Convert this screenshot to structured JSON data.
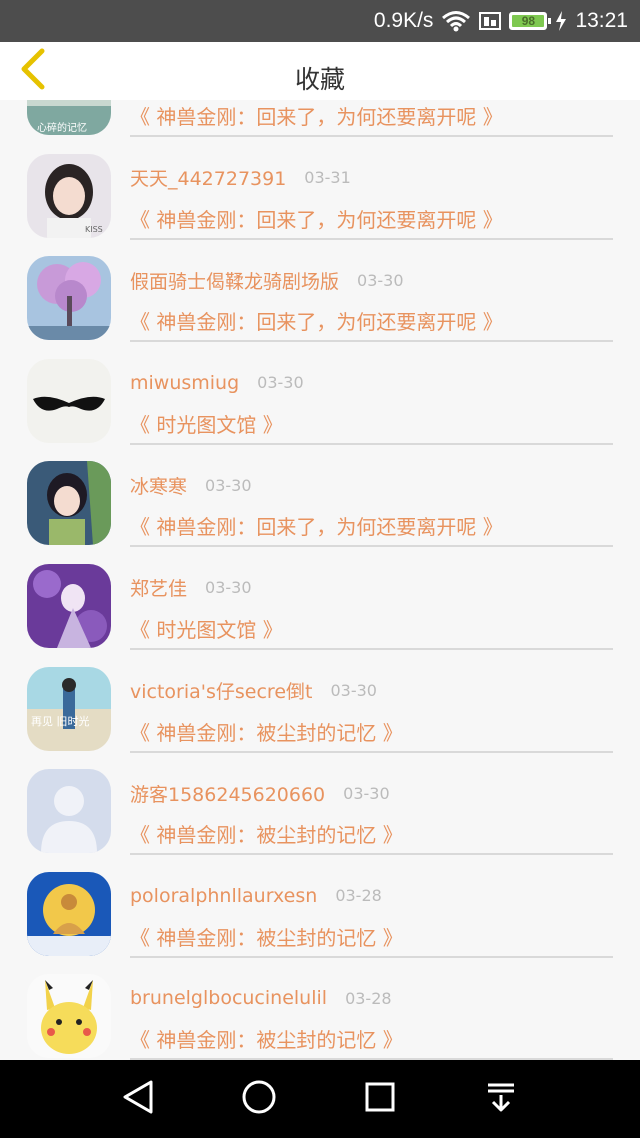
{
  "status_bar": {
    "net_speed": "0.9K/s",
    "battery": "98",
    "time": "13:21"
  },
  "header": {
    "title": "收藏"
  },
  "items": [
    {
      "name": "",
      "date": "",
      "topic": "《 神兽金刚：回来了，为何还要离开呢 》",
      "avatar_text": "心碎的记忆"
    },
    {
      "name": "天天_442727391",
      "date": "03-31",
      "topic": "《 神兽金刚：回来了，为何还要离开呢 》",
      "avatar_text": "KISS"
    },
    {
      "name": "假面骑士偈鞣龙骑剧场版",
      "date": "03-30",
      "topic": "《 神兽金刚：回来了，为何还要离开呢 》",
      "avatar_text": ""
    },
    {
      "name": "miwusmiug",
      "date": "03-30",
      "topic": "《 时光图文馆 》",
      "avatar_text": ""
    },
    {
      "name": "冰寒寒",
      "date": "03-30",
      "topic": "《 神兽金刚：回来了，为何还要离开呢 》",
      "avatar_text": ""
    },
    {
      "name": "郑艺佳",
      "date": "03-30",
      "topic": "《 时光图文馆 》",
      "avatar_text": ""
    },
    {
      "name": "victoria's仔secre倒t",
      "date": "03-30",
      "topic": "《 神兽金刚：被尘封的记忆 》",
      "avatar_text": "再见 旧时光"
    },
    {
      "name": "游客1586245620660",
      "date": "03-30",
      "topic": "《 神兽金刚：被尘封的记忆 》",
      "avatar_text": ""
    },
    {
      "name": "poloralphnllaurxesn",
      "date": "03-28",
      "topic": "《 神兽金刚：被尘封的记忆 》",
      "avatar_text": ""
    },
    {
      "name": "brunelglbocucinelulil",
      "date": "03-28",
      "topic": "《 神兽金刚：被尘封的记忆 》",
      "avatar_text": ""
    }
  ],
  "icons": {
    "back": "chevron-left-icon",
    "nav": [
      "back-triangle-icon",
      "home-circle-icon",
      "recents-square-icon",
      "notification-pull-icon"
    ]
  },
  "colors": {
    "accent": "#e8935f",
    "back_icon": "#e6c200",
    "date": "#bbbbbb",
    "status_bar": "#4d4d4d",
    "nav_bar": "#000000"
  }
}
